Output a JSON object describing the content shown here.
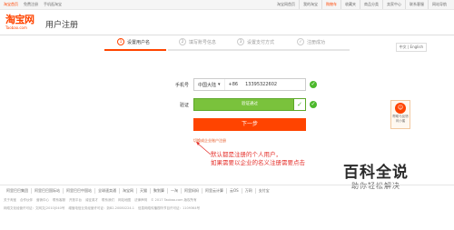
{
  "topbar": {
    "home": "淘宝首页",
    "left_items": [
      "免费注册",
      "手机逛淘宝"
    ],
    "right_items": [
      "淘宝网首页",
      "我的淘宝",
      "购物车",
      "收藏夹",
      "商品分类",
      "卖家中心",
      "联系客服",
      "网站导航"
    ]
  },
  "header": {
    "logo_cn": "淘宝网",
    "logo_en": "Taobao.com",
    "title": "用户注册"
  },
  "steps": [
    {
      "num": "1",
      "label": "设置用户名"
    },
    {
      "num": "2",
      "label": "填写账号信息"
    },
    {
      "num": "3",
      "label": "设置支付方式"
    },
    {
      "num": "✓",
      "label": "注册成功"
    }
  ],
  "lang": "中文 | English",
  "form": {
    "phone_label": "手机号",
    "country": "中国大陆",
    "country_code": "+86",
    "phone_value": "13395322602",
    "verify_label": "验证",
    "slider_text": "验证通过",
    "next_button": "下一步",
    "business_link": "切换成企业账户注册"
  },
  "annotation": {
    "line1": "默认都是注册的个人用户，",
    "line2": "如果需要以企业的名义注册需要点击"
  },
  "help": {
    "line1": "帮助与反馈",
    "line2": "问小蜜"
  },
  "watermark": {
    "big": "百科全说",
    "small": "助你轻松解决"
  },
  "footer": {
    "links": [
      "阿里巴巴集团",
      "阿里巴巴国际站",
      "阿里巴巴中国站",
      "全球速卖通",
      "淘宝网",
      "天猫",
      "聚划算",
      "一淘",
      "阿里妈妈",
      "阿里云计算",
      "云OS",
      "万网",
      "支付宝"
    ],
    "line2": [
      "关于淘宝",
      "合作伙伴",
      "营销中心",
      "联系客服",
      "开放平台",
      "诚征英才",
      "联系我们",
      "网站地图",
      "法律声明",
      "© 2017 Taobao.com 版权所有"
    ],
    "line3": [
      "网络文化经营许可证：文网文[2010]040号",
      "增值电信业务经营许可证：浙B2-20080224-1",
      "信息网络传播视听节目许可证：1109364号"
    ]
  },
  "colors": {
    "accent": "#ff4400",
    "success": "#7ac23c",
    "annotation": "#e5322d"
  }
}
